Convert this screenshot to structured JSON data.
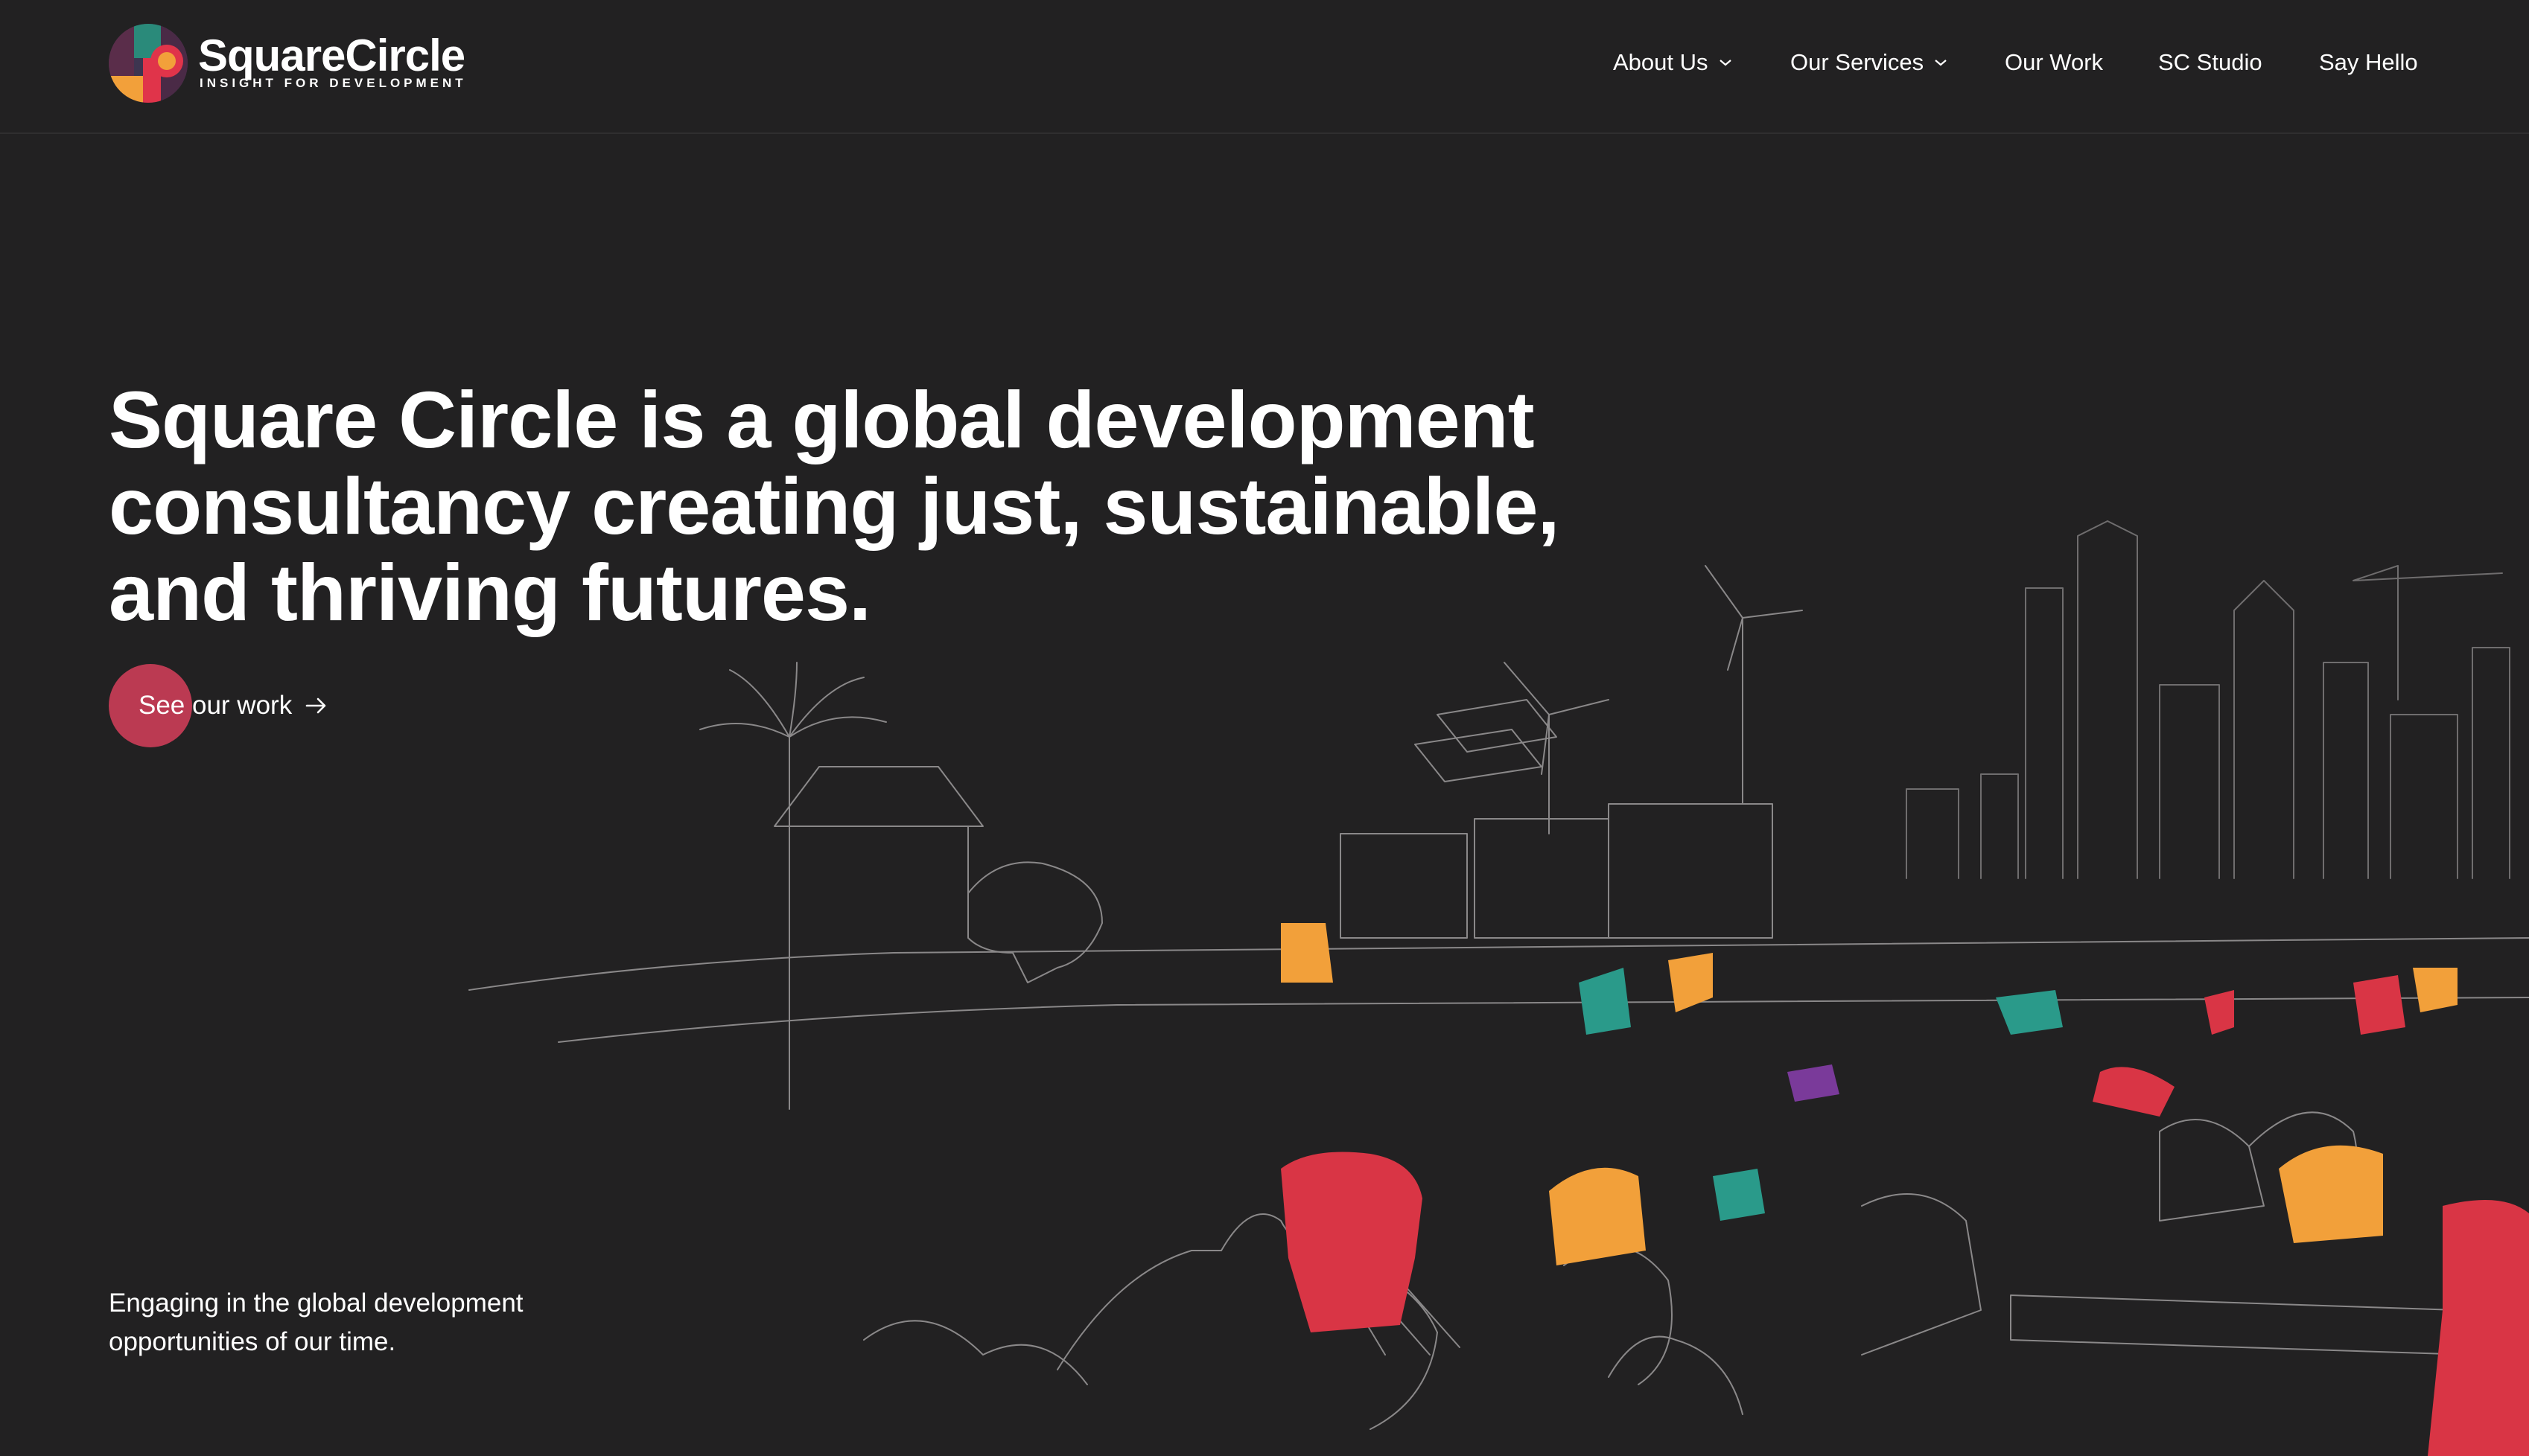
{
  "brand": {
    "name": "SquareCircle",
    "tagline": "INSIGHT FOR DEVELOPMENT",
    "colors": {
      "red": "#e0344a",
      "orange": "#f2a03a",
      "plum": "#5a2d4a",
      "teal": "#2a9a8a",
      "navy": "#3a3a5a"
    }
  },
  "nav": {
    "items": [
      {
        "label": "About Us",
        "has_dropdown": true
      },
      {
        "label": "Our Services",
        "has_dropdown": true
      },
      {
        "label": "Our Work",
        "has_dropdown": false
      },
      {
        "label": "SC Studio",
        "has_dropdown": false
      },
      {
        "label": "Say Hello",
        "has_dropdown": false
      }
    ]
  },
  "hero": {
    "title_lines": [
      "Square Circle is a global development",
      "consultancy creating just, sustainable,",
      "and thriving futures."
    ],
    "cta_label": "See our work",
    "cta_icon": "arrow-right-icon",
    "subtext": "Engaging in the global development opportunities of our time."
  },
  "theme": {
    "background": "#222122",
    "accent": "#bb3a52",
    "line_art": "#8a8889"
  }
}
